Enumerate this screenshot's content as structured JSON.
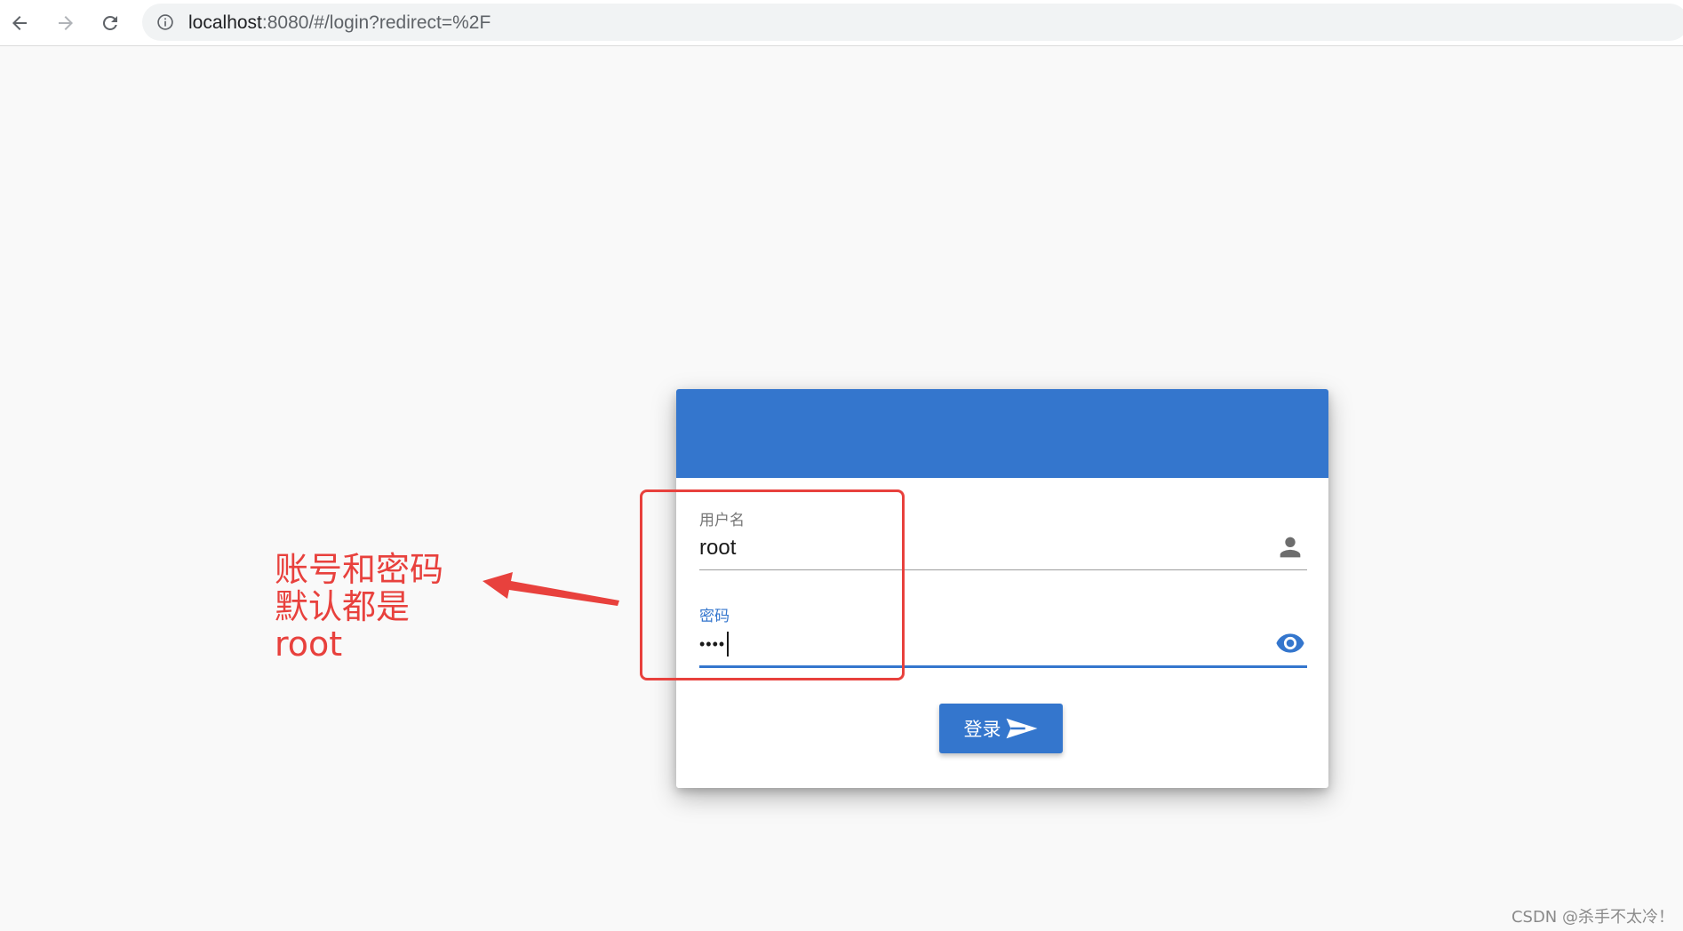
{
  "browser": {
    "url_host": "localhost",
    "url_rest": ":8080/#/login?redirect=%2F",
    "icons": [
      "back-arrow-icon",
      "forward-arrow-icon",
      "reload-icon",
      "info-icon"
    ]
  },
  "login_form": {
    "username_label": "用户名",
    "username_value": "root",
    "password_label": "密码",
    "password_masked": "••••",
    "submit_label": "登录",
    "icons": [
      "person-icon",
      "eye-icon",
      "send-icon"
    ]
  },
  "annotation": {
    "line1": "账号和密码",
    "line2": "默认都是",
    "line3": "root"
  },
  "watermark": "CSDN @杀手不太冷！",
  "colors": {
    "primary": "#3476cd",
    "annotation_red": "#e8413d",
    "page_background": "#f9f9f9"
  }
}
